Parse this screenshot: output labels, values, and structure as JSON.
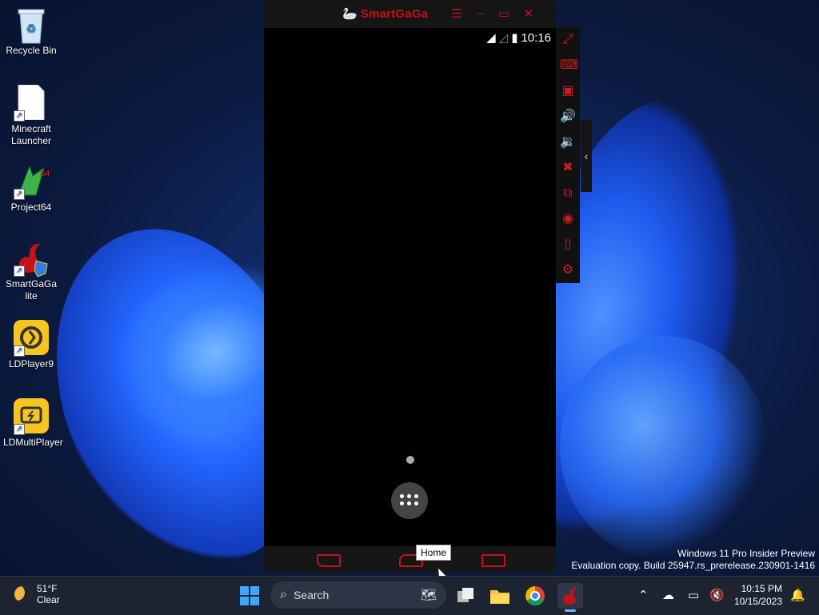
{
  "desktop_icons": [
    {
      "label": "Recycle Bin"
    },
    {
      "label": "Minecraft Launcher"
    },
    {
      "label": "Project64"
    },
    {
      "label": "SmartGaGa lite"
    },
    {
      "label": "LDPlayer9"
    },
    {
      "label": "LDMultiPlayer"
    }
  ],
  "emulator": {
    "title": "SmartGaGa",
    "time": "10:16",
    "toolbar_icons": [
      "fullscreen-icon",
      "keyboard-icon",
      "apk-icon",
      "volume-up-icon",
      "volume-down-icon",
      "close-app-icon",
      "multi-instance-icon",
      "location-icon",
      "shake-icon",
      "settings-icon"
    ],
    "accent": "#c4111a"
  },
  "tooltip": "Home",
  "watermark": {
    "line1": "Windows 11 Pro Insider Preview",
    "line2": "Evaluation copy. Build 25947.rs_prerelease.230901-1416"
  },
  "taskbar": {
    "weather_temp": "51°F",
    "weather_cond": "Clear",
    "search_placeholder": "Search",
    "time": "10:15 PM",
    "date": "10/15/2023"
  }
}
